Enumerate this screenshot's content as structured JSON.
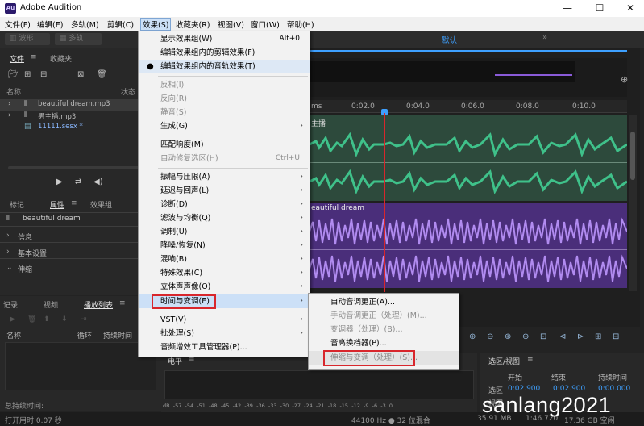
{
  "titlebar": {
    "logo": "Au",
    "title": "Adobe Audition",
    "minimize": "—",
    "maximize": "☐",
    "close": "✕"
  },
  "menubar": [
    "文件(F)",
    "编辑(E)",
    "多轨(M)",
    "剪辑(C)",
    "效果(S)",
    "收藏夹(R)",
    "视图(V)",
    "窗口(W)",
    "帮助(H)"
  ],
  "toolbar": {
    "waveform": "波形",
    "multitrack": "多轨",
    "workspace": "默认"
  },
  "files_panel": {
    "tab_files": "文件",
    "tab_favorites": "收藏夹",
    "col_name": "名称",
    "col_status": "状态",
    "items": [
      {
        "name": "beautiful dream.mp3"
      },
      {
        "name": "男主播.mp3"
      },
      {
        "name": "11111.sesx *"
      }
    ]
  },
  "properties_panel": {
    "tab_markers": "标记",
    "tab_properties": "属性",
    "tab_effects_group": "效果组",
    "clip_name": "beautiful dream",
    "sections": [
      "信息",
      "基本设置",
      "伸缩"
    ]
  },
  "playlist_panel": {
    "tab_history": "记录",
    "tab_video": "视频",
    "tab_playlist": "播放列表",
    "col_name": "名称",
    "col_loop": "循环",
    "col_duration": "持续时间",
    "total": "总持续时间:"
  },
  "editor": {
    "ruler": [
      "ms",
      "0:02.0",
      "0:04.0",
      "0:06.0",
      "0:08.0",
      "0:10.0"
    ],
    "track1_name": "主播",
    "track2_name": "eautiful dream",
    "colors": {
      "green": "#3fc18a",
      "purple": "#b18bf0",
      "playhead": "#d8262c"
    }
  },
  "level_panel": {
    "title": "电平",
    "scale": [
      "dB",
      "-57",
      "-54",
      "-51",
      "-48",
      "-45",
      "-42",
      "-39",
      "-36",
      "-33",
      "-30",
      "-27",
      "-24",
      "-21",
      "-18",
      "-15",
      "-12",
      "-9",
      "-6",
      "-3",
      "0"
    ]
  },
  "selection_panel": {
    "title": "选区/视图",
    "col_start": "开始",
    "col_end": "结束",
    "col_duration": "持续时间",
    "row_label": "选区",
    "start": "0:02.900",
    "end": "0:02.900",
    "duration": "0:00.000",
    "row2_label": "视图"
  },
  "statusbar": {
    "left": "打开用时 0.07 秒",
    "format": "44100 Hz ● 32 位混合",
    "size": "35.91 MB",
    "time": "1:46.720",
    "free": "17.36 GB 空闲"
  },
  "effects_menu": {
    "items": [
      {
        "label": "显示效果组(W)",
        "shortcut": "Alt+0",
        "disabled": false
      },
      {
        "label": "编辑效果组内的剪辑效果(F)",
        "disabled": false
      },
      {
        "label": "编辑效果组内的音轨效果(T)",
        "disabled": false,
        "bullet": "●"
      },
      {
        "label": "反相(I)",
        "disabled": true
      },
      {
        "label": "反向(R)",
        "disabled": true
      },
      {
        "label": "静音(S)",
        "disabled": true
      },
      {
        "label": "生成(G)",
        "disabled": false,
        "arrow": "›"
      },
      {
        "label": "匹配响度(M)",
        "disabled": false
      },
      {
        "label": "自动修复选区(H)",
        "shortcut": "Ctrl+U",
        "disabled": true
      },
      {
        "label": "振幅与压限(A)",
        "arrow": "›"
      },
      {
        "label": "延迟与回声(L)",
        "arrow": "›"
      },
      {
        "label": "诊断(D)",
        "arrow": "›"
      },
      {
        "label": "滤波与均衡(Q)",
        "arrow": "›"
      },
      {
        "label": "调制(U)",
        "arrow": "›"
      },
      {
        "label": "降噪/恢复(N)",
        "arrow": "›"
      },
      {
        "label": "混响(B)",
        "arrow": "›"
      },
      {
        "label": "特殊效果(C)",
        "arrow": "›"
      },
      {
        "label": "立体声声像(O)",
        "arrow": "›"
      },
      {
        "label": "时间与变调(E)",
        "arrow": "›"
      },
      {
        "label": "VST(V)",
        "arrow": "›"
      },
      {
        "label": "批处理(S)",
        "arrow": "›"
      },
      {
        "label": "音频增效工具管理器(P)..."
      }
    ]
  },
  "time_pitch_submenu": {
    "items": [
      {
        "label": "自动音调更正(A)...",
        "disabled": false
      },
      {
        "label": "手动音调更正（处理）(M)...",
        "disabled": true
      },
      {
        "label": "变调器（处理）(B)...",
        "disabled": true
      },
      {
        "label": "音高换档器(P)...",
        "disabled": false
      },
      {
        "label": "伸缩与变调（处理）(S)...",
        "disabled": true
      }
    ]
  },
  "watermark": "sanlang2021"
}
